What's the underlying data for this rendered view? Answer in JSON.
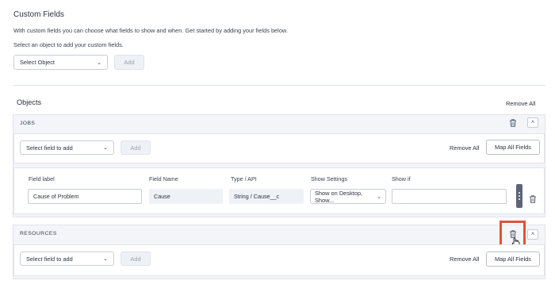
{
  "header": {
    "title": "Custom Fields",
    "description": "With custom fields you can choose what fields to show and when. Get started by adding your fields below.",
    "select_hint": "Select an object to add your custom fields.",
    "select_object": "Select Object",
    "add_label": "Add"
  },
  "objects": {
    "title": "Objects",
    "remove_all": "Remove All"
  },
  "jobs": {
    "heading": "JOBS",
    "select_field": "Select field to add",
    "add_label": "Add",
    "remove_all": "Remove All",
    "map_all": "Map All Fields",
    "columns": {
      "field_label": "Field label",
      "field_name": "Field Name",
      "type_api": "Type / API",
      "show_settings": "Show Settings",
      "show_if": "Show if"
    },
    "row": {
      "field_label": "Cause of Problem",
      "field_name": "Cause",
      "type_api": "String / Cause__c",
      "show_settings": "Show on Desktop, Show...",
      "show_if": ""
    }
  },
  "resources": {
    "heading": "RESOURCES",
    "select_field": "Select field to add",
    "add_label": "Add",
    "remove_all": "Remove All",
    "map_all": "Map All Fields"
  },
  "colors": {
    "highlight": "#e0523a",
    "panel_bg": "#f3f5f8"
  }
}
